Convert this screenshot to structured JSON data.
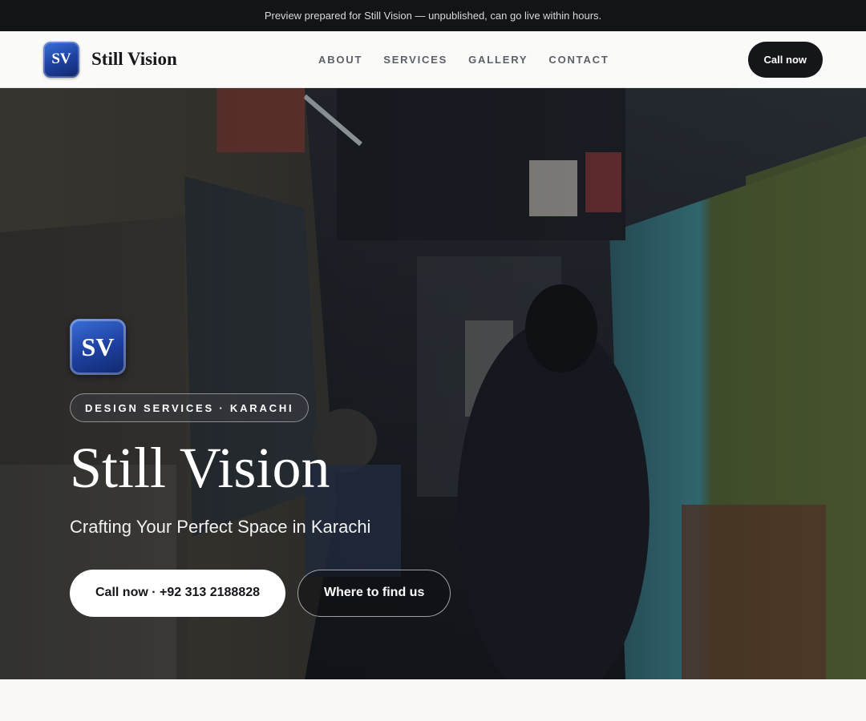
{
  "banner": {
    "text": "Preview prepared for Still Vision — unpublished, can go live within hours."
  },
  "header": {
    "logo_text": "SV",
    "brand_name": "Still Vision",
    "nav": [
      {
        "label": "ABOUT"
      },
      {
        "label": "SERVICES"
      },
      {
        "label": "GALLERY"
      },
      {
        "label": "CONTACT"
      }
    ],
    "call_label": "Call now"
  },
  "hero": {
    "logo_text": "SV",
    "tag": "DESIGN SERVICES · KARACHI",
    "title": "Still Vision",
    "subtitle": "Crafting Your Perfect Space in Karachi",
    "primary_cta": "Call now · +92 313 2188828",
    "secondary_cta": "Where to find us"
  },
  "colors": {
    "accent": "#1d3f9e",
    "dark": "#15161a",
    "banner_bg": "#131418"
  }
}
